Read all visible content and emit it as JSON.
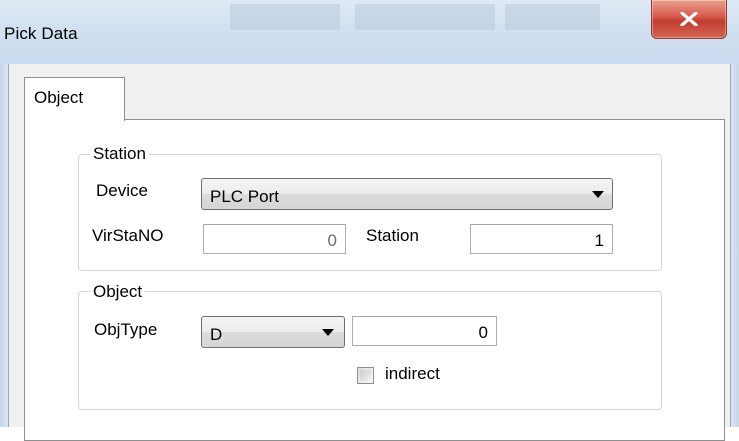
{
  "window": {
    "title": "Pick Data",
    "close_icon": "close-x-icon",
    "accent_close": "#c8412f"
  },
  "tabs": [
    {
      "label": "Object",
      "selected": true
    }
  ],
  "station_group": {
    "caption": "Station",
    "device": {
      "label": "Device",
      "value": "PLC Port"
    },
    "virstano": {
      "label": "VirStaNO",
      "value": "0"
    },
    "station": {
      "label": "Station",
      "value": "1"
    }
  },
  "object_group": {
    "caption": "Object",
    "objtype": {
      "label": "ObjType",
      "value": "D"
    },
    "address": {
      "value": "0"
    },
    "indirect": {
      "label": "indirect",
      "checked": false
    }
  }
}
